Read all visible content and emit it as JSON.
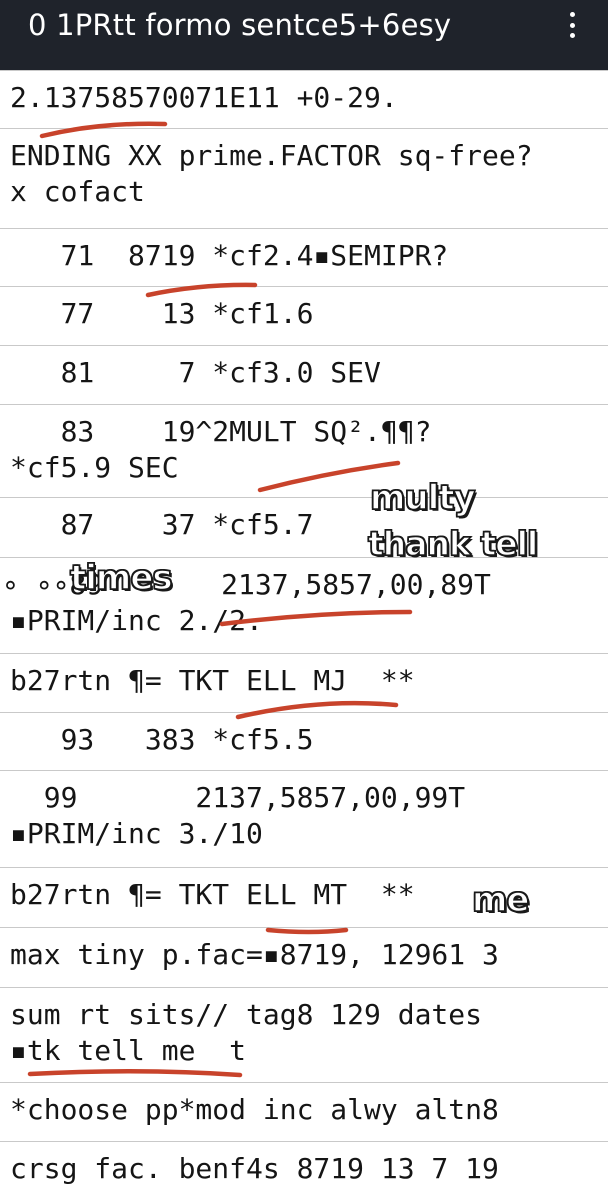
{
  "app_bar": {
    "title": "0 1PRtt formo sentce5+6esy",
    "menu_icon": "more-vert-icon"
  },
  "rows": [
    {
      "lines": [
        "2.13758570071E11 +0-29."
      ]
    },
    {
      "lines": [
        "ENDING XX prime.FACTOR sq-free?",
        "x cofact"
      ]
    },
    {
      "lines": [
        "   71  8719 *cf2.4▪SEMIPR?"
      ]
    },
    {
      "lines": [
        "   77    13 *cf1.6"
      ]
    },
    {
      "lines": [
        "   81     7 *cf3.0 SEV"
      ]
    },
    {
      "lines": [
        "   83    19^2MULT SQ².¶¶?",
        "*cf5.9 SEC"
      ]
    },
    {
      "lines": [
        "   87    37 *cf5.7"
      ]
    },
    {
      "lines": [
        "∘ ∘∘89       2137,5857,00,89T",
        "▪PRIM/inc 2./2."
      ]
    },
    {
      "lines": [
        "b27rtn ¶= TKT ELL MJ  **"
      ]
    },
    {
      "lines": [
        "   93   383 *cf5.5"
      ]
    },
    {
      "lines": [
        "  99       2137,5857,00,99T",
        "▪PRIM/inc 3./10"
      ]
    },
    {
      "lines": [
        "b27rtn ¶= TKT ELL MT  **"
      ]
    },
    {
      "lines": [
        "max tiny p.fac=▪8719, 12961 3"
      ]
    },
    {
      "lines": [
        "sum rt sits// tag8 129 dates",
        "▪tk tell me  t"
      ]
    },
    {
      "lines": [
        "*choose pp*mod inc alwy altn8"
      ]
    },
    {
      "lines": [
        "crsg fac. benf4s 8719 13 7 19"
      ]
    }
  ],
  "stickers": {
    "multy": "multy",
    "thank_tell": "thank tell",
    "times": "times",
    "me": "me"
  },
  "colors": {
    "app_bar": "#1f232b",
    "ink": "#c8432b",
    "divider": "#c9c9c9"
  }
}
